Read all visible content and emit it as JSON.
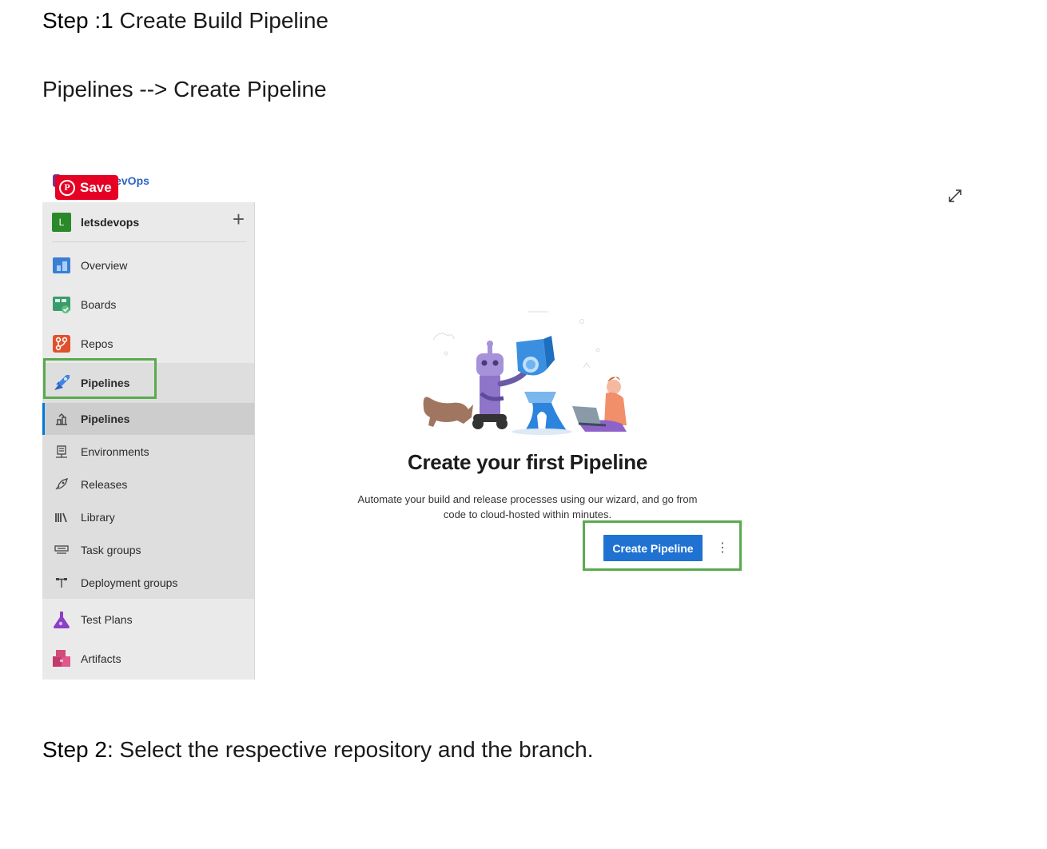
{
  "document": {
    "step1_label": "Step :1",
    "step1_text": "Create Build Pipeline",
    "nav_path": "Pipelines --> Create Pipeline",
    "step2_label": "Step 2:",
    "step2_text": "Select the respective repository and the branch."
  },
  "overlay": {
    "save_label": "Save",
    "logo_text": "DevOps"
  },
  "sidebar": {
    "org_initial": "L",
    "org_name": "letsdevops",
    "org_add": "+",
    "items": [
      {
        "label": "Overview",
        "icon": "overview-icon"
      },
      {
        "label": "Boards",
        "icon": "boards-icon"
      },
      {
        "label": "Repos",
        "icon": "repos-icon"
      },
      {
        "label": "Pipelines",
        "icon": "pipelines-icon"
      }
    ],
    "sub_items": [
      {
        "label": "Pipelines",
        "icon": "pipelines-sub-icon"
      },
      {
        "label": "Environments",
        "icon": "environments-icon"
      },
      {
        "label": "Releases",
        "icon": "releases-icon"
      },
      {
        "label": "Library",
        "icon": "library-icon"
      },
      {
        "label": "Task groups",
        "icon": "task-groups-icon"
      },
      {
        "label": "Deployment groups",
        "icon": "deployment-groups-icon"
      }
    ],
    "bottom_items": [
      {
        "label": "Test Plans",
        "icon": "test-plans-icon"
      },
      {
        "label": "Artifacts",
        "icon": "artifacts-icon"
      }
    ]
  },
  "main": {
    "title": "Create your first Pipeline",
    "description_line1": "Automate your build and release processes using our wizard, and go from",
    "description_line2": "code to cloud-hosted within minutes.",
    "create_button": "Create Pipeline",
    "more_button": "⋮"
  },
  "colors": {
    "highlight_box": "#5aaa4f",
    "primary_button": "#1f72d1",
    "pinterest": "#e60023",
    "active_indicator": "#0078d4"
  }
}
